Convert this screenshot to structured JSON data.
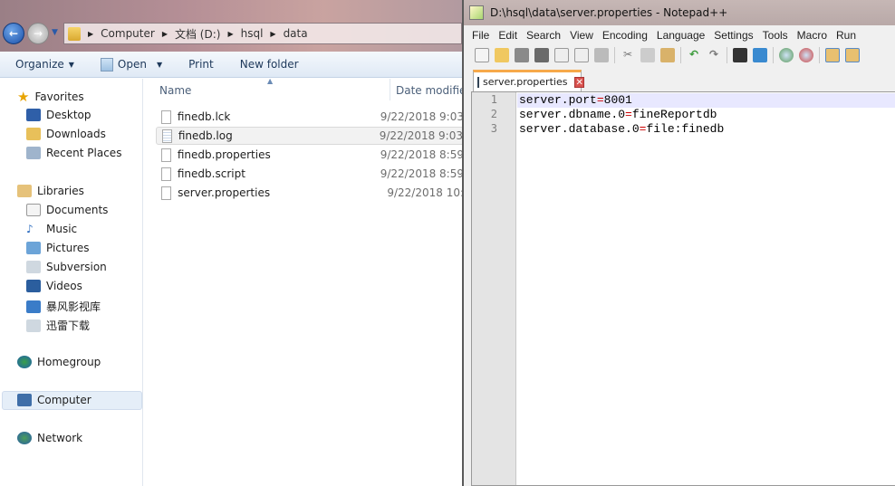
{
  "explorer": {
    "breadcrumb": [
      "Computer",
      "文档 (D:)",
      "hsql",
      "data"
    ],
    "toolbar": {
      "organize": "Organize",
      "open": "Open",
      "print": "Print",
      "new_folder": "New folder"
    },
    "nav": {
      "favorites": "Favorites",
      "desktop": "Desktop",
      "downloads": "Downloads",
      "recent": "Recent Places",
      "libraries": "Libraries",
      "documents": "Documents",
      "music": "Music",
      "pictures": "Pictures",
      "subversion": "Subversion",
      "videos": "Videos",
      "baofeng": "暴风影视库",
      "xunlei": "迅雷下载",
      "homegroup": "Homegroup",
      "computer": "Computer",
      "network": "Network"
    },
    "columns": {
      "name": "Name",
      "date": "Date modified"
    },
    "files": [
      {
        "name": "finedb.lck",
        "date": "9/22/2018 9:03"
      },
      {
        "name": "finedb.log",
        "date": "9/22/2018 9:03"
      },
      {
        "name": "finedb.properties",
        "date": "9/22/2018 8:59"
      },
      {
        "name": "finedb.script",
        "date": "9/22/2018 8:59"
      },
      {
        "name": "server.properties",
        "date": "9/22/2018 10:"
      }
    ]
  },
  "npp": {
    "title": "D:\\hsql\\data\\server.properties - Notepad++",
    "menu": [
      "File",
      "Edit",
      "Search",
      "View",
      "Encoding",
      "Language",
      "Settings",
      "Tools",
      "Macro",
      "Run"
    ],
    "tab": "server.properties",
    "lines": [
      {
        "n": "1",
        "key": "server.port",
        "eq": "=",
        "val": "8001"
      },
      {
        "n": "2",
        "key": "server.dbname.0",
        "eq": "=",
        "val": "fineReportdb"
      },
      {
        "n": "3",
        "key": "server.database.0",
        "eq": "=",
        "val": "file:finedb"
      }
    ]
  }
}
